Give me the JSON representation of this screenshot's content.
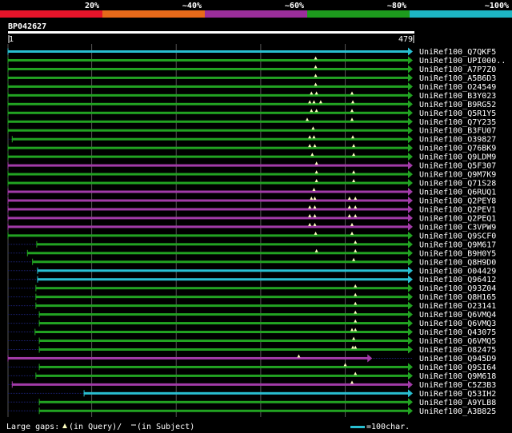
{
  "chart_data": {
    "type": "alignment",
    "query": {
      "name": "BP042627",
      "start": 1,
      "end": 479
    },
    "identity_scale": [
      {
        "label": "20%",
        "color": "#e8142a"
      },
      {
        "label": "~40%",
        "color": "#e86a1a"
      },
      {
        "label": "~60%",
        "color": "#9b2e9b"
      },
      {
        "label": "~80%",
        "color": "#1d9b1d"
      },
      {
        "label": "~100%",
        "color": "#1db5c4"
      }
    ],
    "colors": {
      "cyan": "#29bfd1",
      "green": "#22a322",
      "purple": "#a23ba8",
      "gap_marker": "#ffffc0",
      "dotted": "#1a2070",
      "grid": "#555555"
    },
    "hits": [
      {
        "id": "UniRef100_Q7QKF5",
        "start": 1,
        "end": 479,
        "color": "cyan",
        "gaps": []
      },
      {
        "id": "UniRef100_UPI000..",
        "start": 1,
        "end": 479,
        "color": "green",
        "gaps": [
          365
        ]
      },
      {
        "id": "UniRef100_A7P7Z0",
        "start": 1,
        "end": 479,
        "color": "green",
        "gaps": [
          365
        ]
      },
      {
        "id": "UniRef100_A5B6D3",
        "start": 1,
        "end": 479,
        "color": "green",
        "gaps": [
          365
        ]
      },
      {
        "id": "UniRef100_O24549",
        "start": 1,
        "end": 479,
        "color": "green",
        "gaps": [
          365
        ]
      },
      {
        "id": "UniRef100_B3Y023",
        "start": 1,
        "end": 479,
        "color": "green",
        "gaps": [
          360,
          366,
          408
        ]
      },
      {
        "id": "UniRef100_B9RG52",
        "start": 1,
        "end": 479,
        "color": "green",
        "gaps": [
          358,
          363,
          371,
          409
        ]
      },
      {
        "id": "UniRef100_Q5R1Y5",
        "start": 1,
        "end": 479,
        "color": "green",
        "gaps": [
          360,
          366,
          408
        ]
      },
      {
        "id": "UniRef100_Q7Y235",
        "start": 1,
        "end": 479,
        "color": "green",
        "gaps": [
          355,
          408
        ]
      },
      {
        "id": "UniRef100_B3FU07",
        "start": 1,
        "end": 479,
        "color": "green",
        "gaps": [
          362
        ]
      },
      {
        "id": "UniRef100_O39827",
        "start": 6,
        "end": 479,
        "color": "green",
        "gaps": [
          358,
          363,
          409
        ]
      },
      {
        "id": "UniRef100_Q76BK9",
        "start": 1,
        "end": 479,
        "color": "green",
        "gaps": [
          358,
          364,
          410
        ]
      },
      {
        "id": "UniRef100_Q9LDM9",
        "start": 1,
        "end": 479,
        "color": "green",
        "gaps": [
          361,
          410
        ]
      },
      {
        "id": "UniRef100_Q5F307",
        "start": 1,
        "end": 479,
        "color": "purple",
        "gaps": [
          366
        ]
      },
      {
        "id": "UniRef100_Q9M7K9",
        "start": 1,
        "end": 479,
        "color": "green",
        "gaps": [
          366,
          410
        ]
      },
      {
        "id": "UniRef100_Q71S28",
        "start": 1,
        "end": 479,
        "color": "green",
        "gaps": [
          366,
          410
        ]
      },
      {
        "id": "UniRef100_Q6RUQ1",
        "start": 1,
        "end": 479,
        "color": "purple",
        "gaps": [
          363
        ]
      },
      {
        "id": "UniRef100_Q2PEY8",
        "start": 1,
        "end": 479,
        "color": "purple",
        "gaps": [
          360,
          364,
          405,
          412
        ]
      },
      {
        "id": "UniRef100_Q2PEV1",
        "start": 1,
        "end": 479,
        "color": "purple",
        "gaps": [
          358,
          364,
          405,
          412
        ]
      },
      {
        "id": "UniRef100_Q2PEQ1",
        "start": 1,
        "end": 479,
        "color": "purple",
        "gaps": [
          358,
          364,
          405,
          412
        ]
      },
      {
        "id": "UniRef100_C3VPW9",
        "start": 1,
        "end": 479,
        "color": "purple",
        "gaps": [
          358,
          364,
          408
        ]
      },
      {
        "id": "UniRef100_Q9SCF0",
        "start": 1,
        "end": 479,
        "color": "green",
        "gaps": [
          365,
          408
        ]
      },
      {
        "id": "UniRef100_Q9M617",
        "start": 35,
        "end": 479,
        "color": "green",
        "gaps": [
          412
        ]
      },
      {
        "id": "UniRef100_B9H0Y5",
        "start": 24,
        "end": 479,
        "color": "green",
        "gaps": [
          366,
          412
        ]
      },
      {
        "id": "UniRef100_Q8H9D0",
        "start": 30,
        "end": 479,
        "color": "green",
        "gaps": [
          410
        ]
      },
      {
        "id": "UniRef100_O04429",
        "start": 36,
        "end": 479,
        "color": "cyan",
        "gaps": []
      },
      {
        "id": "UniRef100_Q96412",
        "start": 36,
        "end": 479,
        "color": "cyan",
        "gaps": []
      },
      {
        "id": "UniRef100_Q93Z04",
        "start": 34,
        "end": 479,
        "color": "green",
        "gaps": [
          412
        ]
      },
      {
        "id": "UniRef100_Q8H165",
        "start": 34,
        "end": 479,
        "color": "green",
        "gaps": [
          412
        ]
      },
      {
        "id": "UniRef100_O23141",
        "start": 34,
        "end": 479,
        "color": "green",
        "gaps": [
          412
        ]
      },
      {
        "id": "UniRef100_Q6VMQ4",
        "start": 38,
        "end": 479,
        "color": "green",
        "gaps": [
          412
        ]
      },
      {
        "id": "UniRef100_Q6VMQ3",
        "start": 38,
        "end": 479,
        "color": "green",
        "gaps": [
          412
        ]
      },
      {
        "id": "UniRef100_Q43075",
        "start": 33,
        "end": 479,
        "color": "green",
        "gaps": [
          408,
          412
        ]
      },
      {
        "id": "UniRef100_Q6VMQ5",
        "start": 38,
        "end": 479,
        "color": "green",
        "gaps": [
          410
        ]
      },
      {
        "id": "UniRef100_O82475",
        "start": 38,
        "end": 479,
        "color": "green",
        "gaps": [
          409,
          412
        ]
      },
      {
        "id": "UniRef100_Q945D9",
        "start": 1,
        "end": 431,
        "color": "purple",
        "gaps": [
          345
        ]
      },
      {
        "id": "UniRef100_Q9SI64",
        "start": 38,
        "end": 479,
        "color": "green",
        "gaps": [
          400
        ]
      },
      {
        "id": "UniRef100_Q9M618",
        "start": 34,
        "end": 479,
        "color": "green",
        "gaps": [
          412
        ]
      },
      {
        "id": "UniRef100_C5Z3B3",
        "start": 6,
        "end": 479,
        "color": "purple",
        "gaps": [
          408
        ]
      },
      {
        "id": "UniRef100_Q53IH2",
        "start": 91,
        "end": 479,
        "color": "cyan",
        "gaps": []
      },
      {
        "id": "UniRef100_A9YLB8",
        "start": 38,
        "end": 479,
        "color": "green",
        "gaps": []
      },
      {
        "id": "UniRef100_A3B825",
        "start": 38,
        "end": 479,
        "color": "green",
        "gaps": []
      }
    ],
    "footer": {
      "legend_text": "Large gaps: ",
      "legend_query": "(in Query)/",
      "legend_subject": "(in Subject)",
      "scale_text": "=100char."
    }
  }
}
